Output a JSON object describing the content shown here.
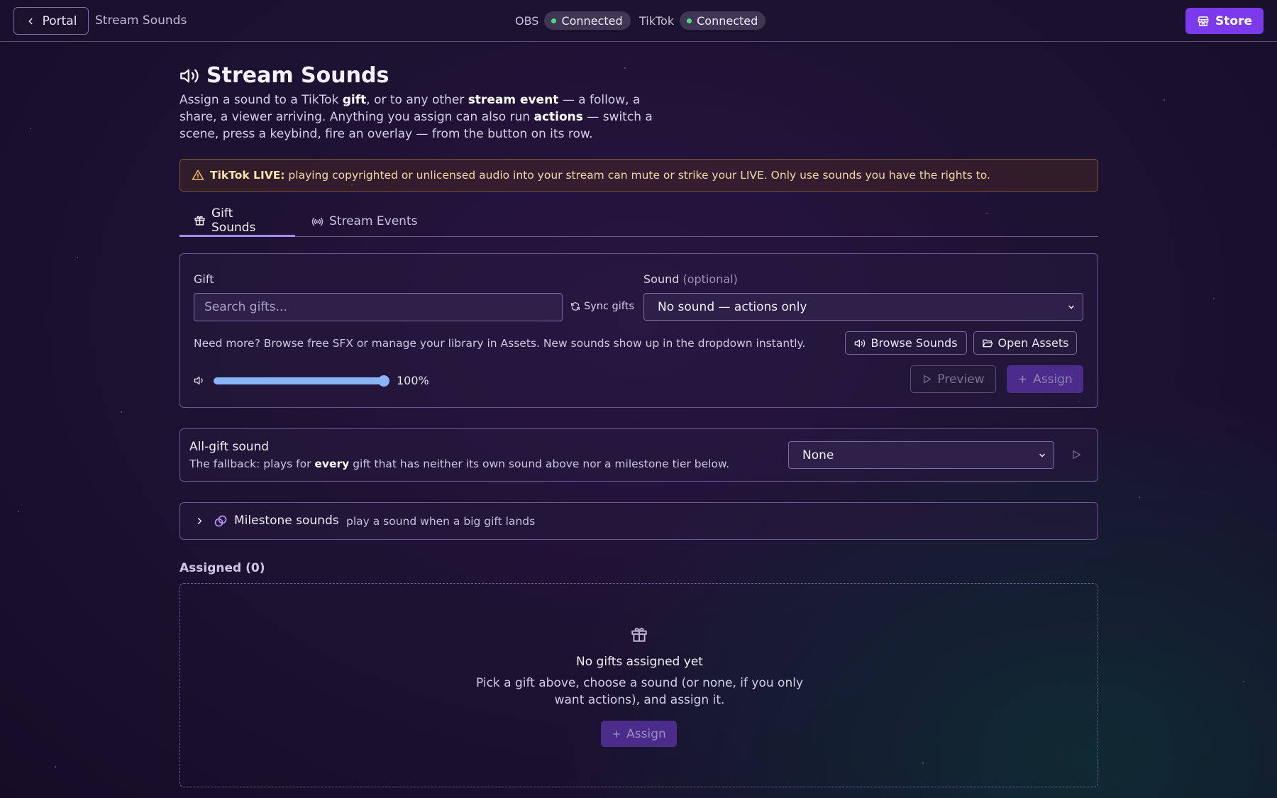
{
  "header": {
    "back_label": "Portal",
    "breadcrumb": "Stream Sounds",
    "obs_label": "OBS",
    "obs_status": "Connected",
    "tiktok_label": "TikTok",
    "tiktok_status": "Connected",
    "store_label": "Store"
  },
  "page": {
    "title": "Stream Sounds",
    "intro_1": "Assign a sound to a TikTok ",
    "intro_b1": "gift",
    "intro_2": ", or to any other ",
    "intro_b2": "stream event",
    "intro_3": " — a follow, a share, a viewer arriving. Anything you assign can also run ",
    "intro_b3": "actions",
    "intro_4": " — switch a scene, press a keybind, fire an overlay — from the button on its row."
  },
  "warning": {
    "bold": "TikTok LIVE:",
    "text": " playing copyrighted or unlicensed audio into your stream can mute or strike your LIVE. Only use sounds you have the rights to."
  },
  "tabs": [
    {
      "label": "Gift Sounds",
      "icon": "gift-icon",
      "active": true
    },
    {
      "label": "Stream Events",
      "icon": "broadcast-icon",
      "active": false
    }
  ],
  "assign_form": {
    "gift_label": "Gift",
    "gift_placeholder": "Search gifts...",
    "sync_label": "Sync gifts",
    "sound_label": "Sound",
    "sound_optional": "(optional)",
    "sound_selected": "No sound — actions only",
    "help_text": "Need more? Browse free SFX or manage your library in Assets. New sounds show up in the dropdown instantly.",
    "browse_label": "Browse Sounds",
    "assets_label": "Open Assets",
    "volume_value": "100%",
    "volume_fraction": 1.0,
    "preview_label": "Preview",
    "assign_label": "Assign"
  },
  "fallback": {
    "title": "All-gift sound",
    "desc_1": "The fallback: plays for ",
    "desc_b": "every",
    "desc_2": " gift that has neither its own sound above nor a milestone tier below.",
    "selected": "None"
  },
  "milestone": {
    "title": "Milestone sounds",
    "subtitle": "play a sound when a big gift lands"
  },
  "assigned": {
    "heading": "Assigned (0)",
    "empty_title": "No gifts assigned yet",
    "empty_desc": "Pick a gift above, choose a sound (or none, if you only want actions), and assign it.",
    "assign_label": "Assign"
  },
  "colors": {
    "accent": "#7c3aed",
    "status_green": "#4ade80",
    "slider": "#8ab4f8"
  }
}
